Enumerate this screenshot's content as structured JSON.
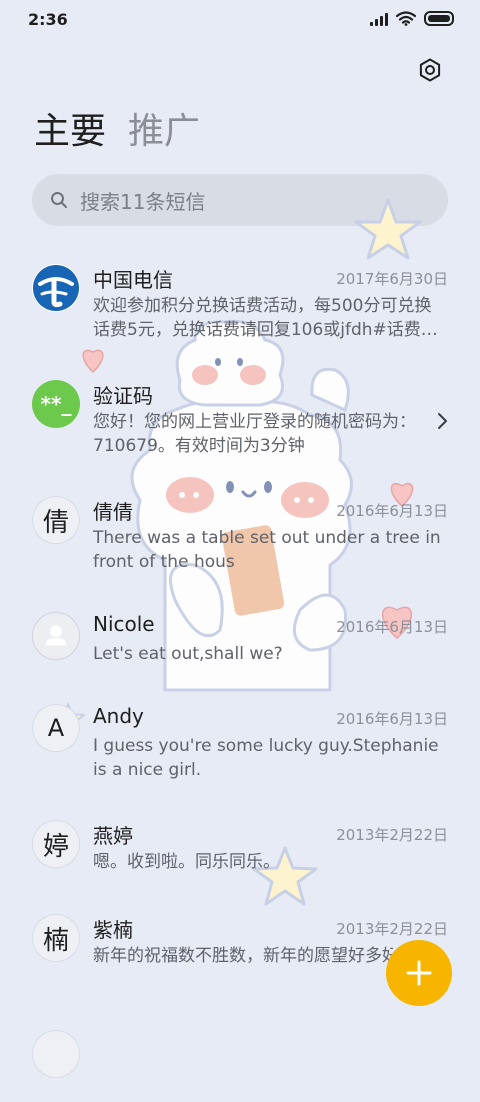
{
  "status": {
    "time": "2:36"
  },
  "tabs": [
    {
      "label": "主要"
    },
    {
      "label": "推广"
    }
  ],
  "search": {
    "placeholder": "搜索11条短信"
  },
  "messages": [
    {
      "name": "中国电信",
      "date": "2017年6月30日",
      "preview": "欢迎参加积分兑换话费活动，每500分可兑换话费5元，兑换话费请回复106或jfdh#话费…",
      "avatar": "telecom-logo"
    },
    {
      "name": "验证码",
      "date": "",
      "preview": "您好！您的网上营业厅登录的随机密码为：710679。有效时间为3分钟",
      "avatar_text": "**_",
      "color": "#6cc94c"
    },
    {
      "name": "倩倩",
      "date": "2016年6月13日",
      "preview": "There was a table set out under a tree in front of the hous",
      "avatar_text": "倩"
    },
    {
      "name": "Nicole",
      "date": "2016年6月13日",
      "preview": "Let's eat out,shall we?",
      "avatar": "person-icon"
    },
    {
      "name": "Andy",
      "date": "2016年6月13日",
      "preview": "I guess you're some lucky guy.Stephanie is a nice girl.",
      "avatar_text": "A"
    },
    {
      "name": "燕婷",
      "date": "2013年2月22日",
      "preview": "嗯。收到啦。同乐同乐。",
      "avatar_text": "婷"
    },
    {
      "name": "紫楠",
      "date": "2013年2月22日",
      "preview": "新年的祝福数不胜数，新年的愿望好多好多，新年的问候依旧美好，在这个温馨的时",
      "avatar_text": "楠"
    }
  ],
  "colors": {
    "background": "#e7ebf5",
    "fab": "#f7b500",
    "accent_green": "#6cc94c",
    "telecom_blue": "#1765b4"
  }
}
